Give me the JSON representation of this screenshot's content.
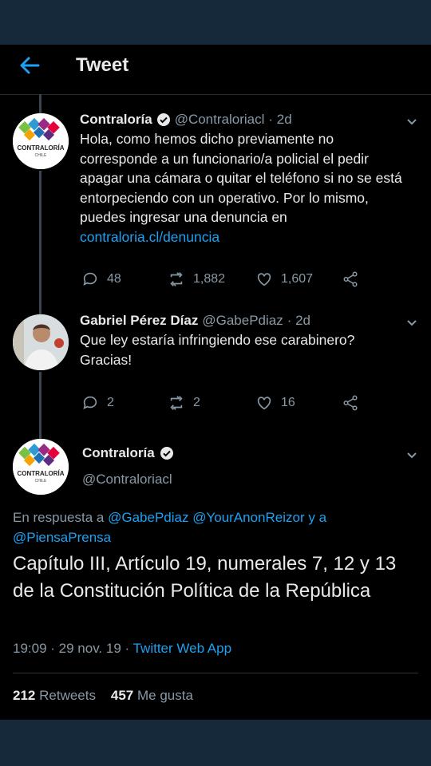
{
  "header": {
    "title": "Tweet"
  },
  "tweets": [
    {
      "name": "Contraloría",
      "handle": "@Contraloriacl",
      "time": "· 2d",
      "text": "Hola, como hemos dicho previamente no corresponde a un funcionario/a policial el pedir apagar una cámara o quitar el teléfono si no se está entorpeciendo con un operativo. Por lo mismo, puedes ingresar una denuncia en",
      "link": "contraloria.cl/denuncia",
      "replies": "48",
      "retweets": "1,882",
      "likes": "1,607",
      "avatar_text": "CONTRALORÍA",
      "avatar_subtext": "CHILE"
    },
    {
      "name": "Gabriel Pérez Díaz",
      "handle": "@GabePdiaz",
      "time": "· 2d",
      "text": "Que ley estaría infringiendo ese carabinero? Gracias!",
      "replies": "2",
      "retweets": "2",
      "likes": "16"
    }
  ],
  "main": {
    "name": "Contraloría",
    "handle": "@Contraloriacl",
    "reply_prefix": "En respuesta a",
    "mention1": "@GabePdiaz",
    "mention2": "@YourAnonReizor",
    "reply_and": "y a",
    "mention3": "@PiensaPrensa",
    "text": "Capítulo III, Artículo 19, numerales 7, 12 y 13 de la Constitución Política de la República",
    "time": "19:09 · 29 nov. 19 ·",
    "source": "Twitter Web App",
    "retweets_count": "212",
    "retweets_label": "Retweets",
    "likes_count": "457",
    "likes_label": "Me gusta",
    "avatar_text": "CONTRALORÍA",
    "avatar_subtext": "CHILE"
  },
  "colors": {
    "accent": "#1da1f2",
    "muted": "#8899a6",
    "bar": "#15293b"
  }
}
